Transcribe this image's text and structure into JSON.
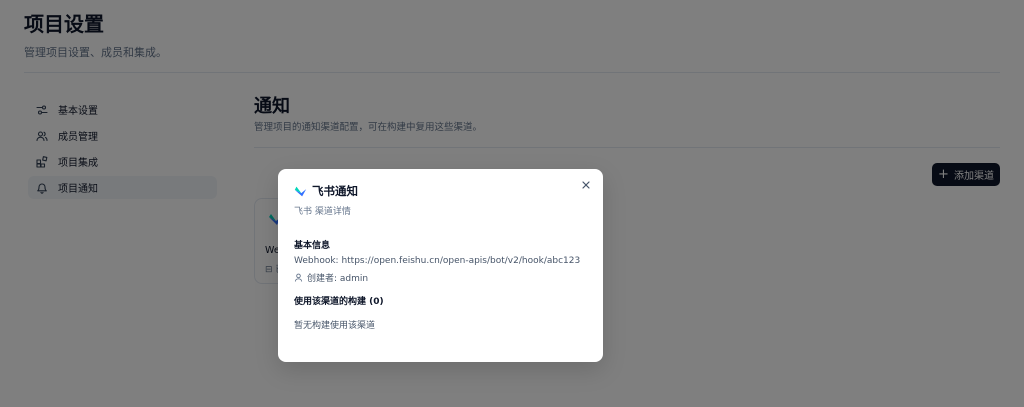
{
  "header": {
    "title": "项目设置",
    "subtitle": "管理项目设置、成员和集成。"
  },
  "sidebar": {
    "items": [
      {
        "label": "基本设置",
        "icon": "sliders-icon"
      },
      {
        "label": "成员管理",
        "icon": "users-icon"
      },
      {
        "label": "项目集成",
        "icon": "integration-icon"
      },
      {
        "label": "项目通知",
        "icon": "bell-icon",
        "active": true
      }
    ]
  },
  "main": {
    "title": "通知",
    "description": "管理项目的通知渠道配置，可在构建中复用这些渠道。",
    "add_button_label": "添加渠道",
    "card": {
      "name_fragment": "We",
      "meta_fragment": "⊟ 已"
    }
  },
  "dialog": {
    "title": "飞书通知",
    "subtitle": "飞书 渠道详情",
    "basic_info_heading": "基本信息",
    "webhook": "Webhook: https://open.feishu.cn/open-apis/bot/v2/hook/abc123",
    "creator": "创建者: admin",
    "builds_heading": "使用该渠道的构建 (0)",
    "empty_builds": "暂无构建使用该渠道"
  },
  "colors": {
    "overlay": "rgba(0,0,0,0.5)",
    "button_bg": "#0f172a",
    "feishu_blue": "#3370ff",
    "feishu_teal": "#00d6b9"
  }
}
